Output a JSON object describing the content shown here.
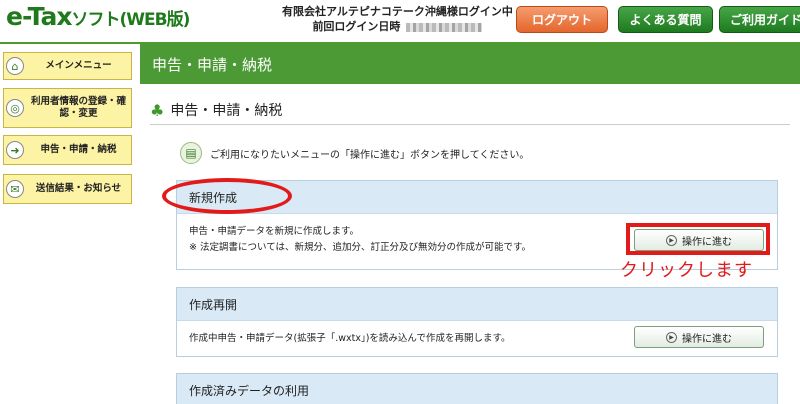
{
  "header": {
    "logo_main": "e-Tax",
    "logo_sub": "ソフト(WEB版)",
    "user_line1": "有限会社アルテピナコテーク沖縄様ログイン中",
    "user_line2": "前回ログイン日時",
    "logout_label": "ログアウト",
    "faq_label": "よくある質問",
    "guide_label": "ご利用ガイド"
  },
  "sidebar": {
    "items": [
      {
        "label": "メインメニュー"
      },
      {
        "label": "利用者情報の登録・確認・変更"
      },
      {
        "label": "申告・申請・納税"
      },
      {
        "label": "送信結果・お知らせ"
      }
    ]
  },
  "main": {
    "banner_title": "申告・申請・納税",
    "section_title": "申告・申請・納税",
    "instruction": "ご利用になりたいメニューの「操作に進む」ボタンを押してください。",
    "panels": [
      {
        "title": "新規作成",
        "line1": "申告・申請データを新規に作成します。",
        "line2": "※ 法定調書については、新規分、追加分、訂正分及び無効分の作成が可能です。",
        "button": "操作に進む"
      },
      {
        "title": "作成再開",
        "line1": "作成中申告・申請データ(拡張子「.wxtx」)を読み込んで作成を再開します。",
        "button": "操作に進む"
      },
      {
        "title": "作成済みデータの利用"
      }
    ]
  },
  "annotation": {
    "callout": "クリックします",
    "color": "#e21a1a"
  },
  "colors": {
    "brand_green": "#4c9a36",
    "sidebar_yellow": "#fcf3a4",
    "panel_header_blue": "#d9eaf6",
    "logout_orange": "#e4662c"
  }
}
